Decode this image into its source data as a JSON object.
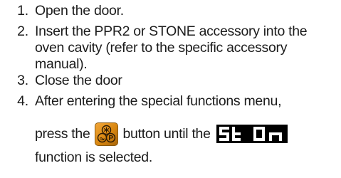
{
  "steps": [
    {
      "number": "1.",
      "lines": [
        "Open the door."
      ]
    },
    {
      "number": "2.",
      "lines": [
        "Insert the PPR2 or STONE accessory into the",
        "oven cavity (refer to the specific accessory",
        "manual)."
      ]
    },
    {
      "number": "3.",
      "lines": [
        "Close the door"
      ]
    },
    {
      "number": "4.",
      "lines": [
        "After entering the special functions menu,"
      ],
      "instruction": {
        "before_button": "press the",
        "between": "button until the",
        "after_display": "function is selected."
      }
    }
  ],
  "button_icon": {
    "name": "pizza-stone-button-icon",
    "letter": "P",
    "background": "#e0901f"
  },
  "display": {
    "text": "St On",
    "background": "#000000",
    "segment_color": "#ffffff"
  }
}
